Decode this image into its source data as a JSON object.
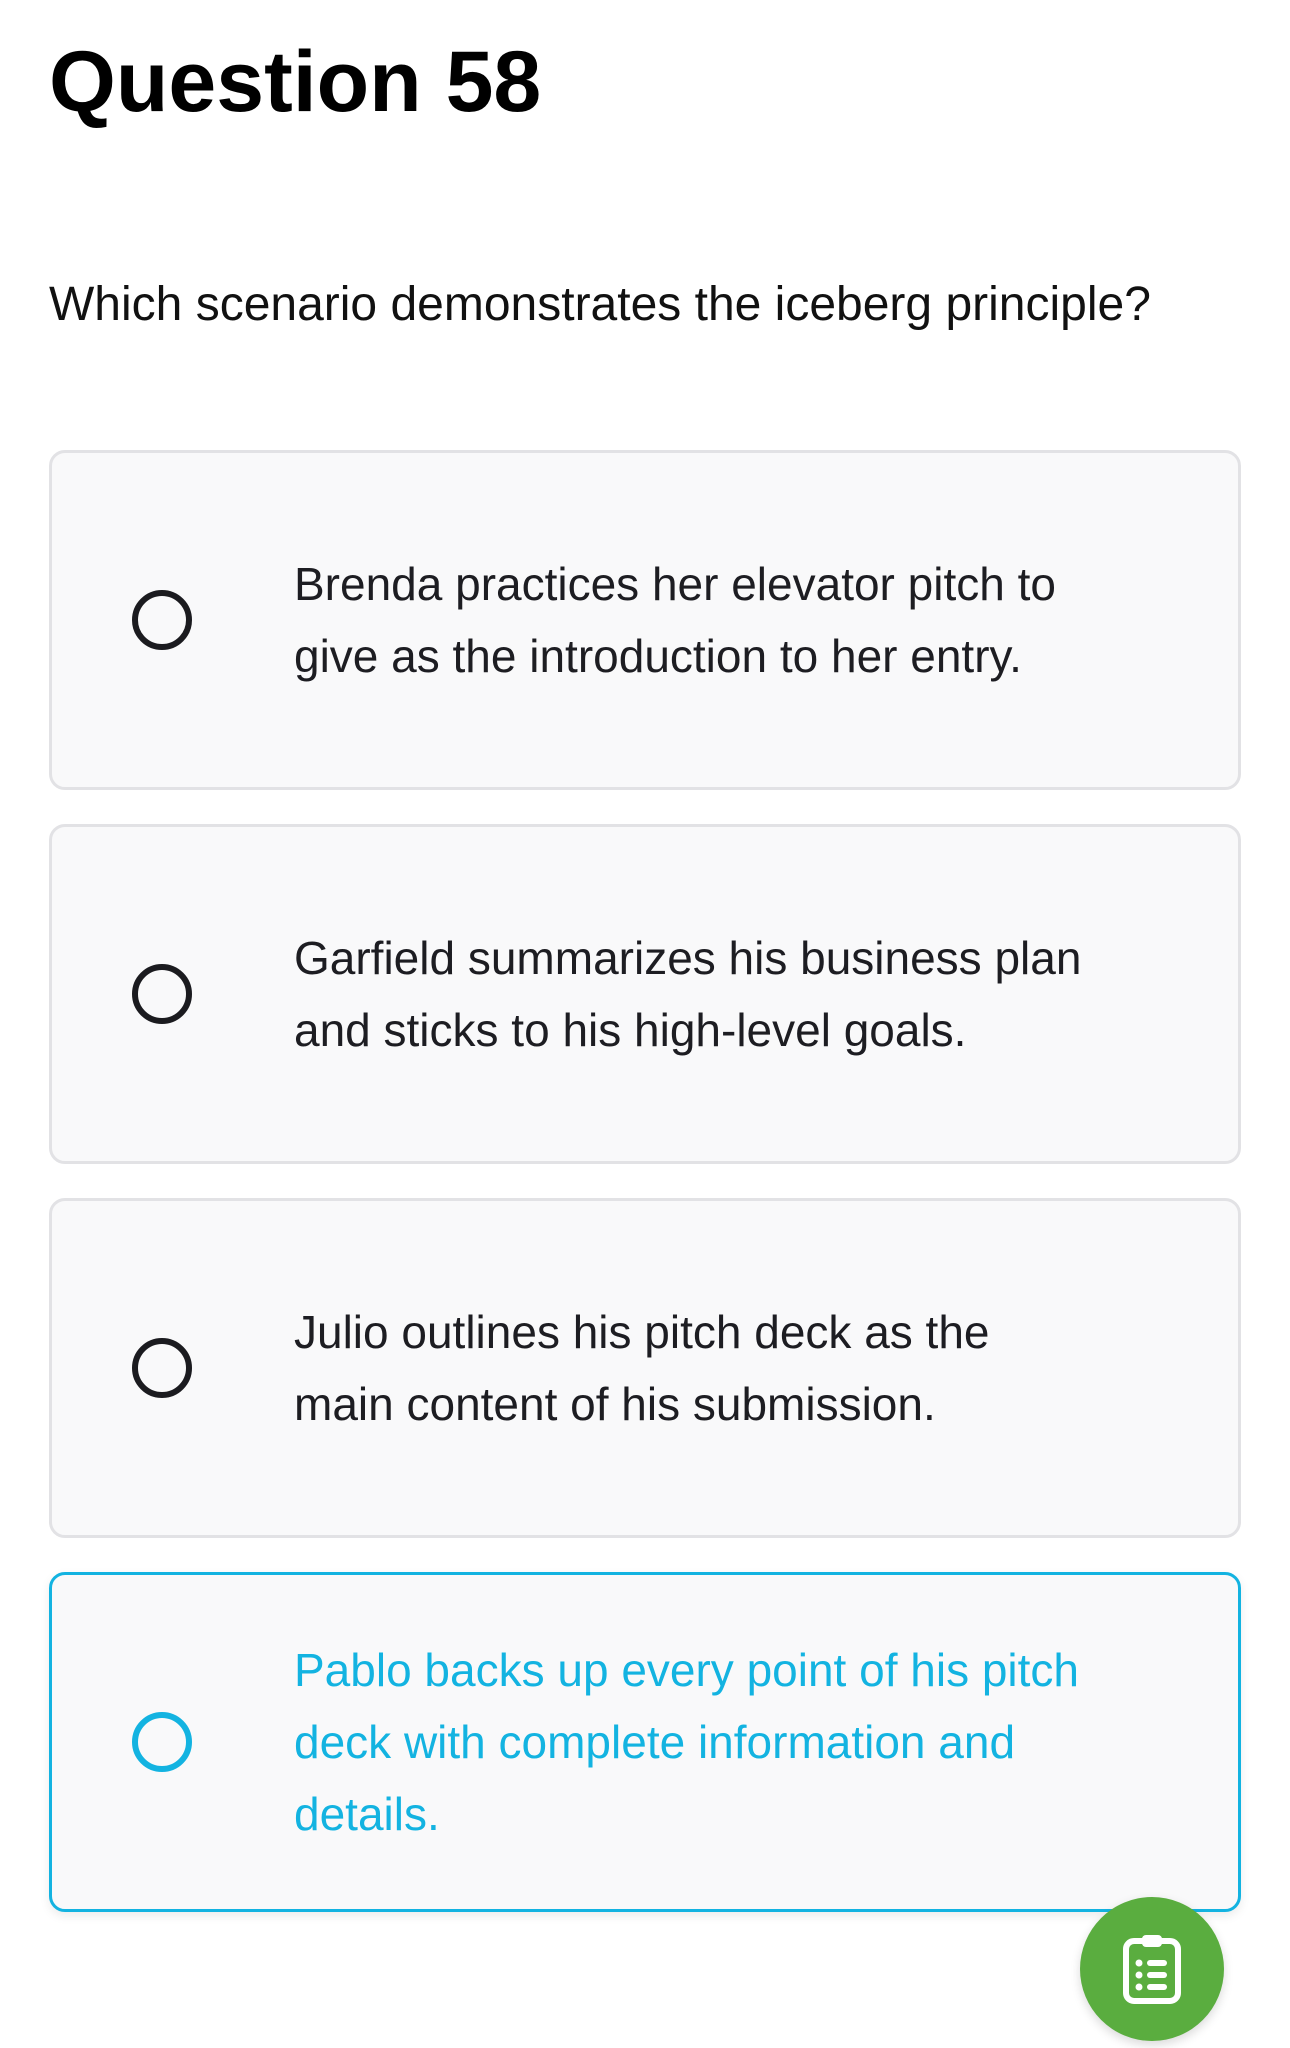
{
  "question": {
    "title": "Question 58",
    "prompt": "Which scenario demonstrates the iceberg principle?"
  },
  "options": [
    {
      "text": "Brenda practices her elevator pitch to give as the introduction to her entry.",
      "selected": false
    },
    {
      "text": "Garfield summarizes his business plan and sticks to his high-level goals.",
      "selected": false
    },
    {
      "text": "Julio outlines his pitch deck as the main content of his submission.",
      "selected": false
    },
    {
      "text": "Pablo backs up every point of his pitch deck with complete information and details.",
      "selected": true
    }
  ],
  "fab": {
    "icon": "clipboard-list-icon"
  },
  "colors": {
    "accent": "#13b3e1",
    "fab": "#5aad3f",
    "card_bg": "#f9f9fa",
    "card_border": "#e2e2e5"
  }
}
